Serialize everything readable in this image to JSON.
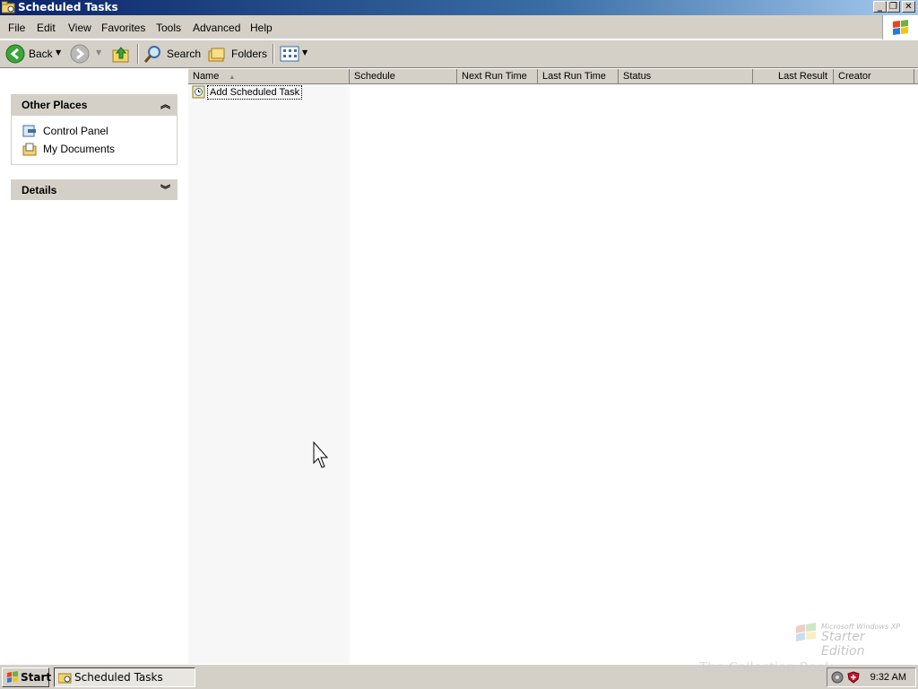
{
  "window": {
    "title": "Scheduled Tasks",
    "controls": {
      "minimize": "_",
      "restore": "❐",
      "close": "✕"
    }
  },
  "menu": {
    "items": [
      "File",
      "Edit",
      "View",
      "Favorites",
      "Tools",
      "Advanced",
      "Help"
    ]
  },
  "toolbar": {
    "back_label": "Back",
    "search_label": "Search",
    "folders_label": "Folders"
  },
  "left_pane": {
    "other_places": {
      "title": "Other Places",
      "links": [
        "Control Panel",
        "My Documents"
      ]
    },
    "details": {
      "title": "Details"
    }
  },
  "columns": [
    "Name",
    "Schedule",
    "Next Run Time",
    "Last Run Time",
    "Status",
    "Last Result",
    "Creator"
  ],
  "items": [
    {
      "name": "Add Scheduled Task"
    }
  ],
  "watermark": {
    "line1": "Microsoft Windows XP",
    "line2": "Starter Edition"
  },
  "taskbar": {
    "start_label": "Start",
    "task_button_label": "Scheduled Tasks",
    "clock": "9:32 AM",
    "watermark": "The Collection Book"
  },
  "colors": {
    "titlebar_start": "#0a246a",
    "titlebar_end": "#a6caf0",
    "chrome": "#d4d0c8"
  }
}
